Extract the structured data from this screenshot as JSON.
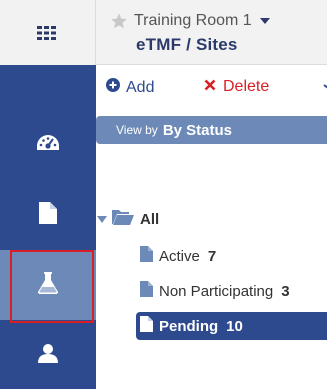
{
  "header": {
    "room_name": "Training Room 1",
    "page_title": "eTMF / Sites"
  },
  "nav": {
    "items": [
      {
        "icon": "dashboard-icon",
        "active": false
      },
      {
        "icon": "document-icon",
        "active": false
      },
      {
        "icon": "flask-icon",
        "active": true
      },
      {
        "icon": "user-icon",
        "active": false
      }
    ]
  },
  "toolbar": {
    "add_label": "Add",
    "delete_label": "Delete"
  },
  "view_by": {
    "label": "View by",
    "value": "By Status"
  },
  "tree": {
    "root_label": "All",
    "nodes": [
      {
        "label": "Active",
        "count": "7",
        "selected": false
      },
      {
        "label": "Non Participating",
        "count": "3",
        "selected": false
      },
      {
        "label": "Pending",
        "count": "10",
        "selected": true
      }
    ]
  },
  "colors": {
    "nav_bg": "#2e4a8e",
    "nav_active": "#6d89b8",
    "title_text": "#2b3a6b",
    "delete_red": "#d81f26",
    "highlight_outline": "#d81f26"
  }
}
